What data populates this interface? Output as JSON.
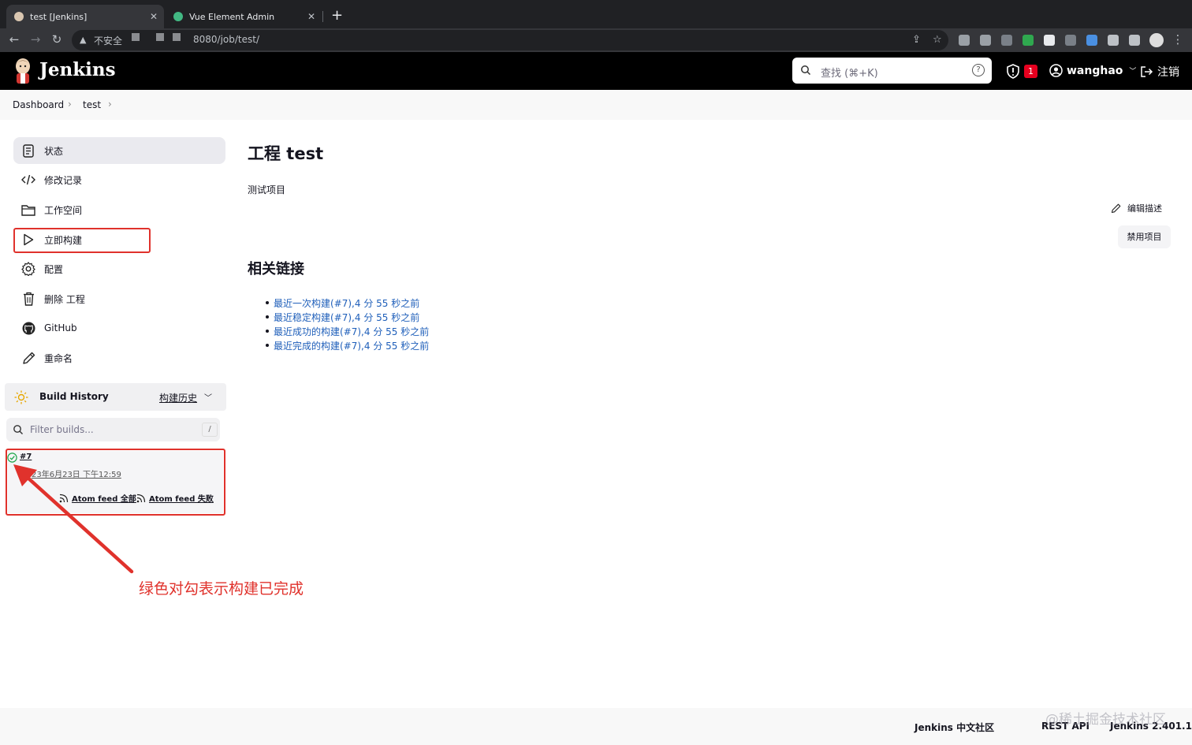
{
  "browser": {
    "tabs": [
      {
        "title": "test [Jenkins]",
        "active": true
      },
      {
        "title": "Vue Element Admin",
        "active": false
      }
    ],
    "new_tab": "+",
    "insecure_label": "不安全",
    "url": "8080/job/test/"
  },
  "header": {
    "brand": "Jenkins",
    "search_placeholder": "查找 (⌘+K)",
    "search_help": "?",
    "security_badge": "1",
    "user": "wanghao",
    "logout": "注销"
  },
  "breadcrumb": [
    "Dashboard",
    "test"
  ],
  "sidebar": {
    "items": [
      {
        "label": "状态",
        "icon": "status-icon"
      },
      {
        "label": "修改记录",
        "icon": "code-icon"
      },
      {
        "label": "工作空间",
        "icon": "folder-icon"
      },
      {
        "label": "立即构建",
        "icon": "play-icon"
      },
      {
        "label": "配置",
        "icon": "gear-icon"
      },
      {
        "label": "删除 工程",
        "icon": "trash-icon"
      },
      {
        "label": "GitHub",
        "icon": "github-icon"
      },
      {
        "label": "重命名",
        "icon": "pencil-icon"
      }
    ]
  },
  "build_history": {
    "title": "Build History",
    "trend_link": "构建历史",
    "filter_placeholder": "Filter builds...",
    "filter_shortcut": "/",
    "builds": [
      {
        "number": "#7",
        "date": "23年6月23日 下午12:59",
        "status": "success"
      }
    ],
    "feed_all": "Atom feed 全部",
    "feed_fail": "Atom feed 失败"
  },
  "annotation": "绿色对勾表示构建已完成",
  "main": {
    "title": "工程 test",
    "description": "测试项目",
    "edit_description": "编辑描述",
    "disable_project": "禁用项目",
    "related_title": "相关链接",
    "related_links": [
      "最近一次构建(#7),4 分 55 秒之前",
      "最近稳定构建(#7),4 分 55 秒之前",
      "最近成功的构建(#7),4 分 55 秒之前",
      "最近完成的构建(#7),4 分 55 秒之前"
    ]
  },
  "footer": {
    "community": "Jenkins 中文社区",
    "rest_api": "REST API",
    "version": "Jenkins 2.401.1"
  },
  "watermark": "@稀土掘金技术社区",
  "colors": {
    "highlight": "#e0322c",
    "link": "#1f5fba",
    "success": "#1ea64b",
    "header_bg": "#000000"
  }
}
